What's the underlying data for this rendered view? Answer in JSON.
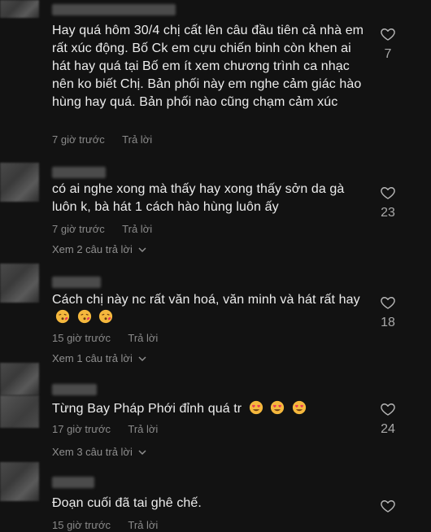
{
  "comments": [
    {
      "text": "Hay quá hôm 30/4 chị cất lên câu đầu tiên cả nhà em rất xúc động. Bố Ck em cựu chiến binh còn khen ai hát hay quá tại Bố em ít xem chương trình ca nhạc nên ko biết Chị. Bản phối này em nghe cảm giác hào hùng hay quá. Bản phối nào cũng chạm cảm xúc",
      "time": "7 giờ trước",
      "reply": "Trả lời",
      "likes": "7"
    },
    {
      "text": "có ai nghe xong mà thấy hay xong thấy sởn da gà luôn k, bà hát 1 cách hào hùng luôn ấy",
      "time": "7 giờ trước",
      "reply": "Trả lời",
      "view_replies": "Xem 2 câu trả lời",
      "likes": "23"
    },
    {
      "text": "Cách chị này nc rất văn hoá, văn minh và hát rất hay",
      "time": "15 giờ trước",
      "reply": "Trả lời",
      "view_replies": "Xem 1 câu trả lời",
      "likes": "18"
    },
    {
      "text": "Từng Bay Pháp Phới đỉnh quá tr",
      "time": "17 giờ trước",
      "reply": "Trả lời",
      "view_replies": "Xem 3 câu trả lời",
      "likes": "24"
    },
    {
      "text": "Đoạn cuối đã tai ghê chế.",
      "time": "15 giờ trước",
      "reply": "Trả lời"
    }
  ],
  "icons": {
    "like": "heart-outline-icon",
    "chevron": "chevron-down-icon",
    "emoji_kiss": "face-blowing-kiss",
    "emoji_love": "smiling-face-with-heart-eyes"
  }
}
